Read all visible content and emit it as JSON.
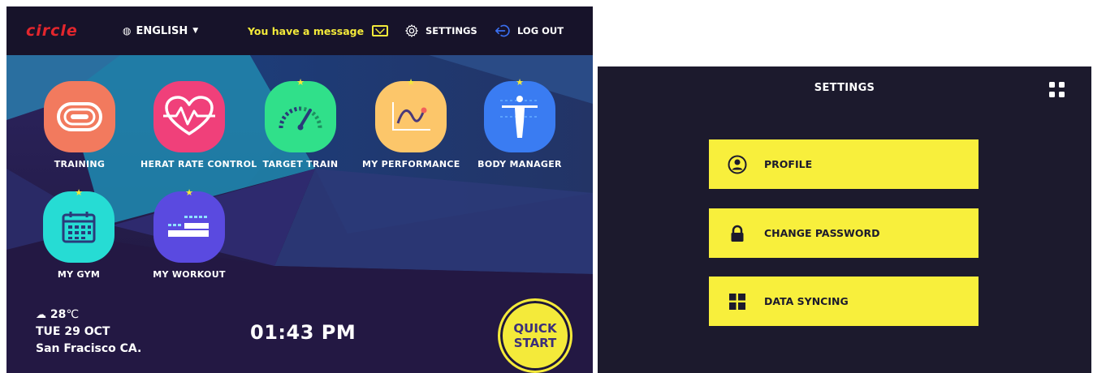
{
  "home": {
    "logo": "circle",
    "language": "ENGLISH",
    "message": "You have a message",
    "settings_label": "SETTINGS",
    "logout_label": "LOG OUT",
    "apps": [
      {
        "label": "TRAINING",
        "icon": "track-icon",
        "color": "#f27a5e",
        "starred": false
      },
      {
        "label": "HERAT RATE CONTROL",
        "icon": "heartbeat-icon",
        "color": "#f0407a",
        "starred": false
      },
      {
        "label": "TARGET TRAIN",
        "icon": "gauge-icon",
        "color": "#30e08a",
        "starred": true
      },
      {
        "label": "MY PERFORMANCE",
        "icon": "line-chart-icon",
        "color": "#fcc66a",
        "starred": true
      },
      {
        "label": "BODY MANAGER",
        "icon": "body-icon",
        "color": "#3a7cf2",
        "starred": true
      },
      {
        "label": "MY GYM",
        "icon": "calendar-icon",
        "color": "#26dcd4",
        "starred": true
      },
      {
        "label": "MY WORKOUT",
        "icon": "workout-icon",
        "color": "#5a4ae0",
        "starred": true
      }
    ],
    "weather": {
      "temp": "28",
      "unit": "℃",
      "date": "TUE 29 OCT",
      "location": "San Fracisco CA."
    },
    "time": "01:43 PM",
    "quick_start": {
      "line1": "QUICK",
      "line2": "START"
    }
  },
  "settings_screen": {
    "title": "SETTINGS",
    "buttons": [
      {
        "label": "PROFILE",
        "icon": "user-icon"
      },
      {
        "label": "CHANGE PASSWORD",
        "icon": "lock-icon"
      },
      {
        "label": "DATA SYNCING",
        "icon": "grid-icon"
      }
    ]
  },
  "colors": {
    "accent_yellow": "#f4ea3a",
    "brand_red": "#e3262d",
    "topbar": "#17132a",
    "settings_bg": "#1c1a2d"
  }
}
